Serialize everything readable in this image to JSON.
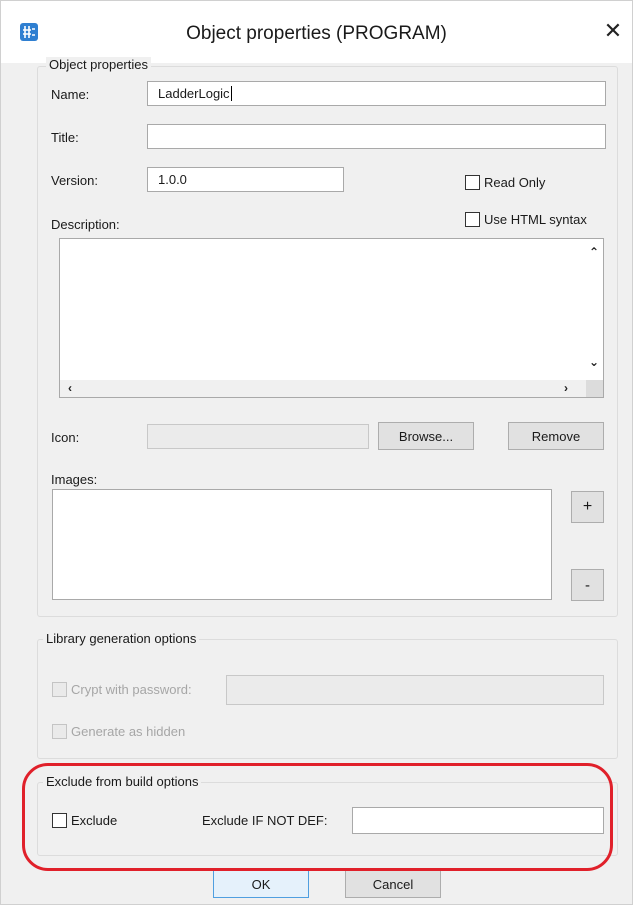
{
  "window": {
    "title": "Object properties (PROGRAM)",
    "close_label": "✕"
  },
  "object_properties": {
    "legend": "Object properties",
    "name_label": "Name:",
    "name_value": "LadderLogic",
    "title_label": "Title:",
    "title_value": "",
    "version_label": "Version:",
    "version_value": "1.0.0",
    "read_only_label": "Read Only",
    "read_only_checked": false,
    "description_label": "Description:",
    "use_html_label": "Use HTML syntax",
    "use_html_checked": false,
    "description_value": "",
    "icon_label": "Icon:",
    "icon_value": "",
    "browse_label": "Browse...",
    "remove_label": "Remove",
    "images_label": "Images:",
    "add_label": "+",
    "minus_label": "-"
  },
  "library_options": {
    "legend": "Library generation options",
    "crypt_label": "Crypt with password:",
    "crypt_value": "",
    "hidden_label": "Generate as hidden"
  },
  "exclude_options": {
    "legend": "Exclude from build options",
    "exclude_label": "Exclude",
    "exclude_checked": false,
    "ifnotdef_label": "Exclude IF NOT DEF:",
    "ifnotdef_value": ""
  },
  "footer": {
    "ok_label": "OK",
    "cancel_label": "Cancel"
  },
  "colors": {
    "highlight": "#e0202a",
    "app_icon": "#2f7fd1"
  }
}
